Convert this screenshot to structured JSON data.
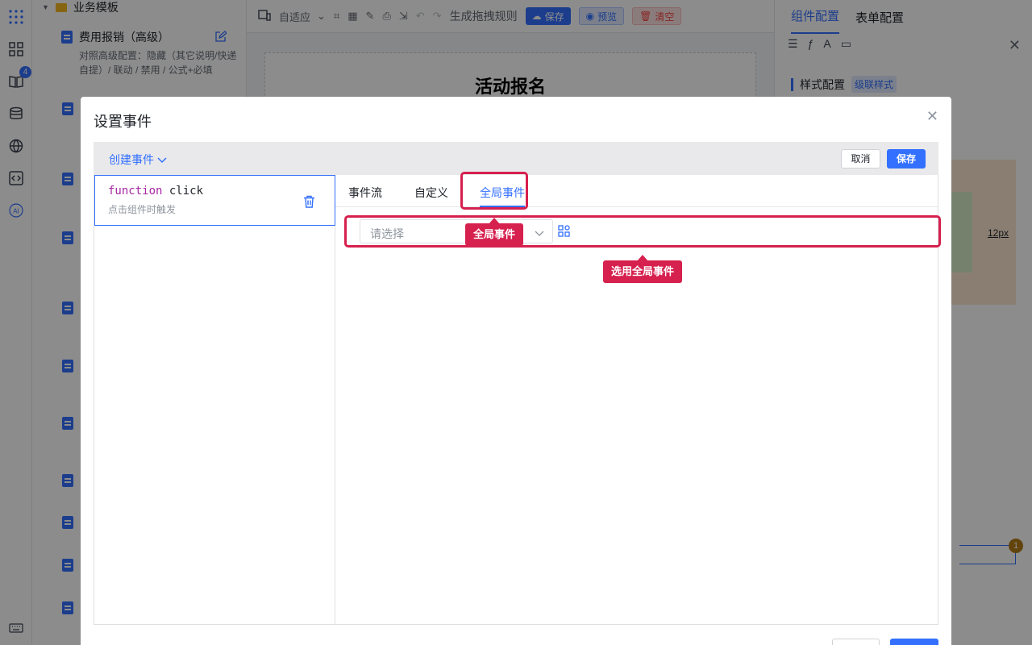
{
  "rail": {
    "badge_count": "4"
  },
  "tree": {
    "group_label": "业务模板",
    "item_title": "费用报销（高级）",
    "item_desc": "对照高级配置：隐藏（其它说明/快递自提）/ 联动 / 禁用 / 公式+必填"
  },
  "toolbar": {
    "adaptive_label": "自适应",
    "drag_rule_label": "生成拖拽规则",
    "save_label": "保存",
    "preview_label": "预览",
    "clear_label": "清空"
  },
  "canvas": {
    "form_title": "活动报名"
  },
  "right_panel": {
    "tab_component": "组件配置",
    "tab_form": "表单配置",
    "section_style": "样式配置",
    "cascade_style": "级联样式",
    "size_value": "12px",
    "warning_count": "1"
  },
  "dialog": {
    "title": "设置事件",
    "create_event_label": "创建事件",
    "cancel_label": "取消",
    "save_label": "保存",
    "event": {
      "keyword": "function",
      "name": "click",
      "description": "点击组件时触发"
    },
    "tabs": [
      "事件流",
      "自定义",
      "全局事件"
    ],
    "active_tab": "全局事件",
    "select_placeholder": "请选择"
  },
  "annotations": {
    "tab_callout": "全局事件",
    "select_callout": "选用全局事件",
    "accent_color": "#d6204e"
  },
  "colors": {
    "primary": "#3370ff"
  }
}
